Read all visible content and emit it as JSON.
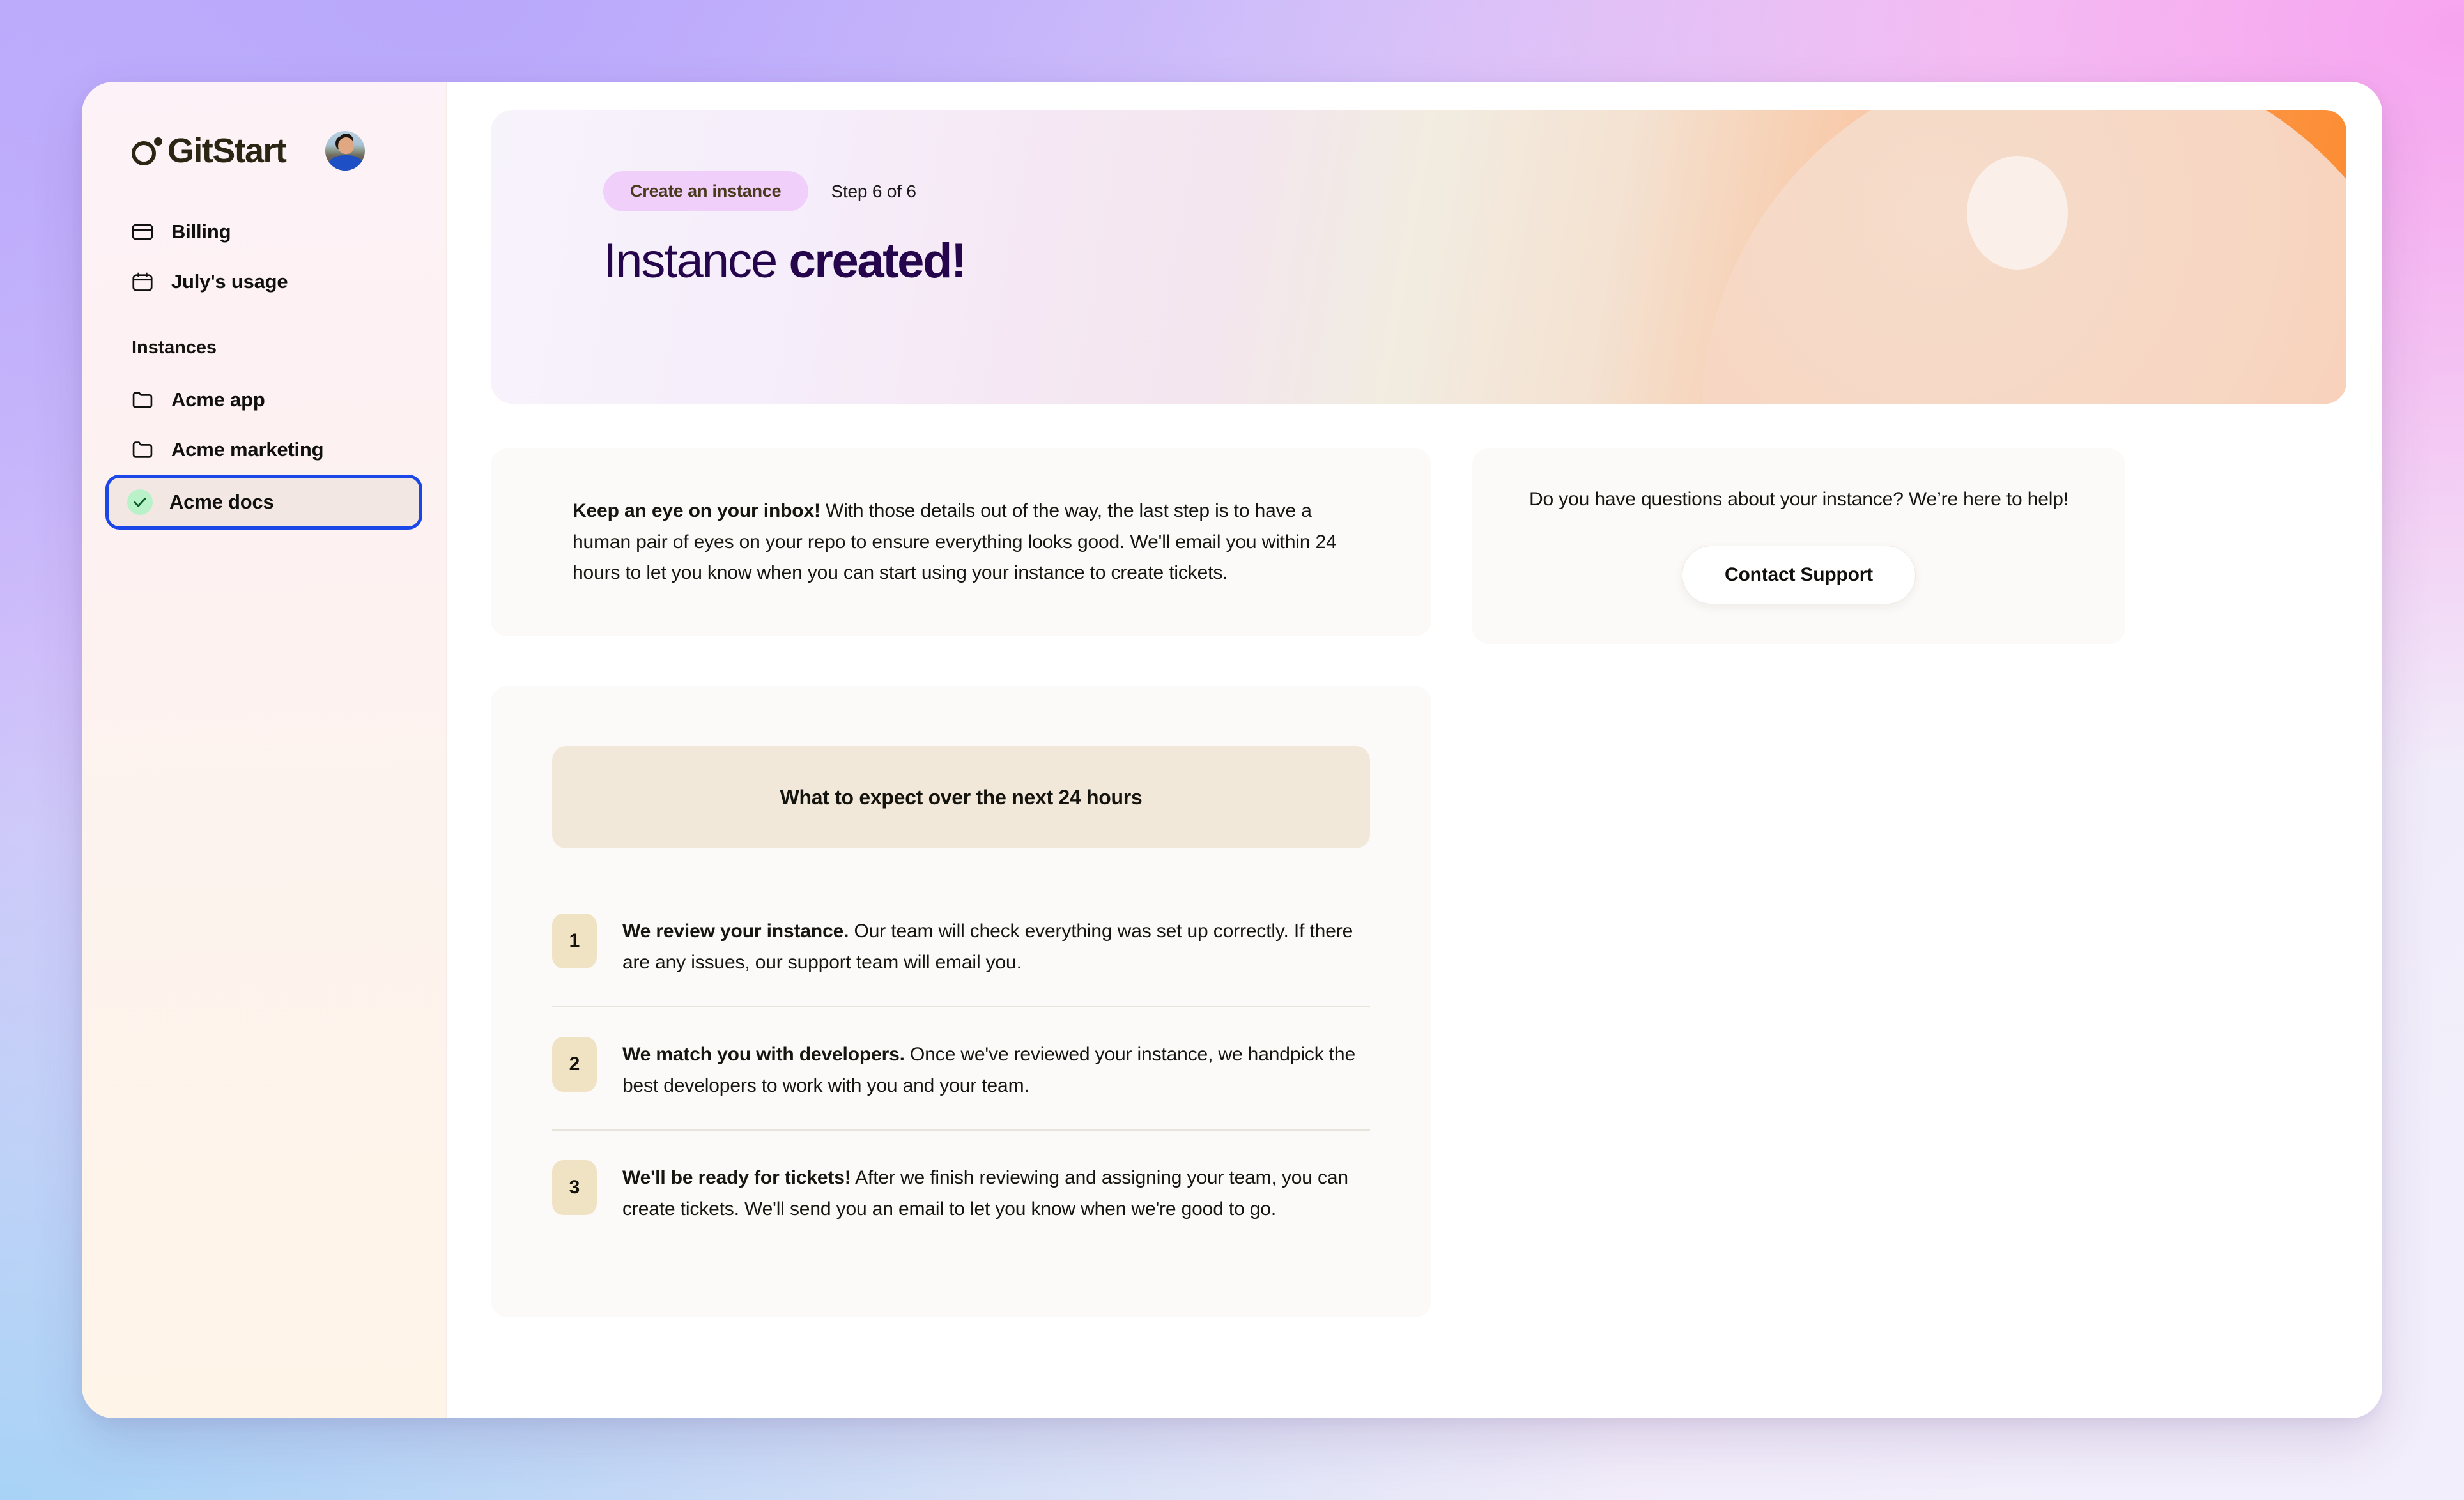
{
  "brand": {
    "name": "GitStart",
    "logo_icon": "gitstart-circle-degree-icon",
    "avatar_icon": "user-avatar"
  },
  "sidebar": {
    "nav": [
      {
        "label": "Billing",
        "icon": "credit-card-icon"
      },
      {
        "label": "July's usage",
        "icon": "calendar-icon"
      }
    ],
    "section_title": "Instances",
    "instances": [
      {
        "label": "Acme app",
        "icon": "folder-icon",
        "selected": false
      },
      {
        "label": "Acme marketing",
        "icon": "folder-icon",
        "selected": false
      },
      {
        "label": "Acme docs",
        "icon": "check-circle-icon",
        "selected": true
      }
    ]
  },
  "hero": {
    "pill_label": "Create an instance",
    "step_label": "Step 6 of 6",
    "title_light": "Instance",
    "title_bold": "created!",
    "accent_orange": "#fc8a2e",
    "pill_bg": "#f0cffa",
    "title_color": "#25054b"
  },
  "inbox_card": {
    "lead": "Keep an eye on your inbox!",
    "body": " With those details out of the way, the last step is to have a human pair of eyes on your repo to ensure everything looks good. We'll email you within 24 hours to let you know when you can start using your instance to create tickets."
  },
  "support_card": {
    "text": "Do you have questions about your instance? We’re here to help!",
    "button_label": "Contact Support"
  },
  "expect_card": {
    "header": "What to expect over the next 24 hours",
    "steps": [
      {
        "num": "1",
        "lead": "We review your instance.",
        "body": " Our team will check everything was set up correctly. If there are any issues, our support team will email you."
      },
      {
        "num": "2",
        "lead": "We match you with developers.",
        "body": " Once we've reviewed your instance, we handpick the best developers to work with you and your team."
      },
      {
        "num": "3",
        "lead": "We'll be ready for tickets!",
        "body": " After we finish reviewing and assigning your team, you can create tickets. We'll send you an email to let you know when we're good to go."
      }
    ]
  }
}
